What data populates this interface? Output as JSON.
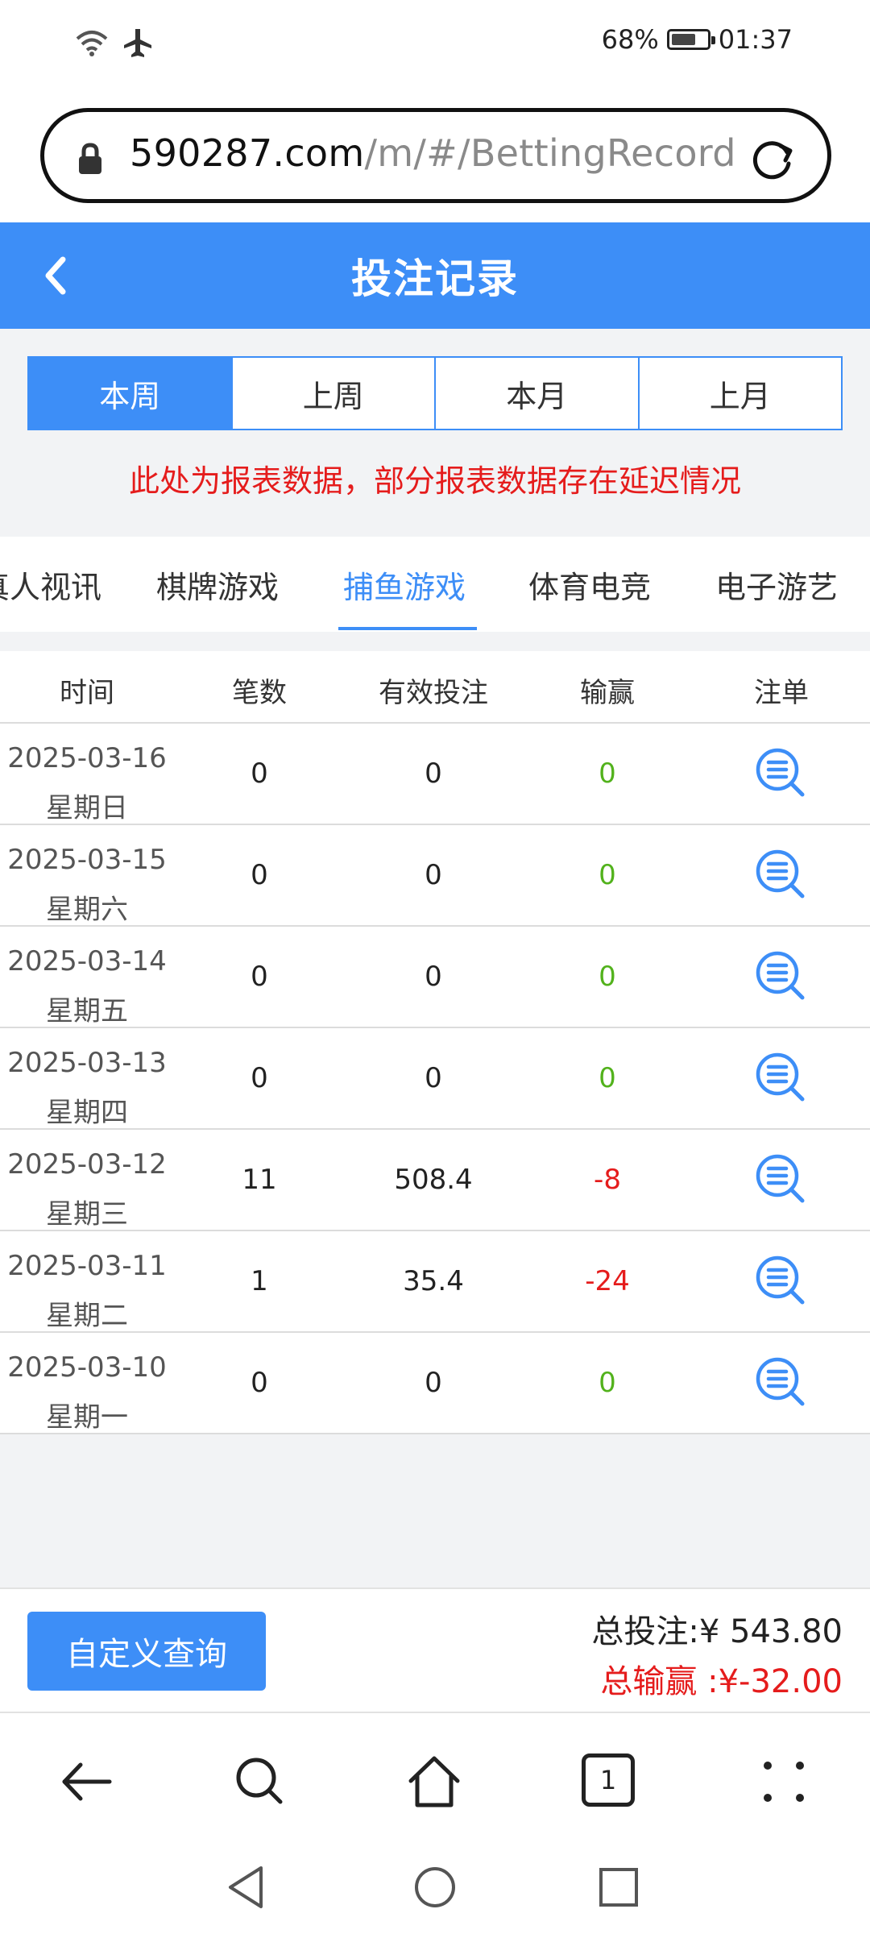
{
  "status_bar": {
    "battery": "68%",
    "battery_level": 0.68,
    "time": "01:37"
  },
  "address_bar": {
    "host": "590287.com",
    "path": "/m/#/BettingRecord"
  },
  "header": {
    "title": "投注记录"
  },
  "period_tabs": [
    {
      "label": "本周",
      "active": true
    },
    {
      "label": "上周",
      "active": false
    },
    {
      "label": "本月",
      "active": false
    },
    {
      "label": "上月",
      "active": false
    }
  ],
  "notice": "此处为报表数据，部分报表数据存在延迟情况",
  "game_tabs": [
    {
      "label": "真人视讯",
      "active": false
    },
    {
      "label": "棋牌游戏",
      "active": false
    },
    {
      "label": "捕鱼游戏",
      "active": true
    },
    {
      "label": "体育电竞",
      "active": false
    },
    {
      "label": "电子游艺",
      "active": false
    }
  ],
  "table": {
    "headers": [
      "时间",
      "笔数",
      "有效投注",
      "输赢",
      "注单"
    ],
    "rows": [
      {
        "date": "2025-03-16",
        "weekday": "星期日",
        "count": "0",
        "bet": "0",
        "win": "0"
      },
      {
        "date": "2025-03-15",
        "weekday": "星期六",
        "count": "0",
        "bet": "0",
        "win": "0"
      },
      {
        "date": "2025-03-14",
        "weekday": "星期五",
        "count": "0",
        "bet": "0",
        "win": "0"
      },
      {
        "date": "2025-03-13",
        "weekday": "星期四",
        "count": "0",
        "bet": "0",
        "win": "0"
      },
      {
        "date": "2025-03-12",
        "weekday": "星期三",
        "count": "11",
        "bet": "508.4",
        "win": "-8"
      },
      {
        "date": "2025-03-11",
        "weekday": "星期二",
        "count": "1",
        "bet": "35.4",
        "win": "-24"
      },
      {
        "date": "2025-03-10",
        "weekday": "星期一",
        "count": "0",
        "bet": "0",
        "win": "0"
      }
    ]
  },
  "summary": {
    "custom_query": "自定义查询",
    "total_bet": "总投注:¥ 543.80",
    "total_win": "总输赢 :¥-32.00"
  },
  "browser_nav": {
    "tab_count": "1"
  },
  "colors": {
    "accent": "#3d8ef7",
    "negative": "#e51c1c",
    "zero": "#52b21c"
  }
}
